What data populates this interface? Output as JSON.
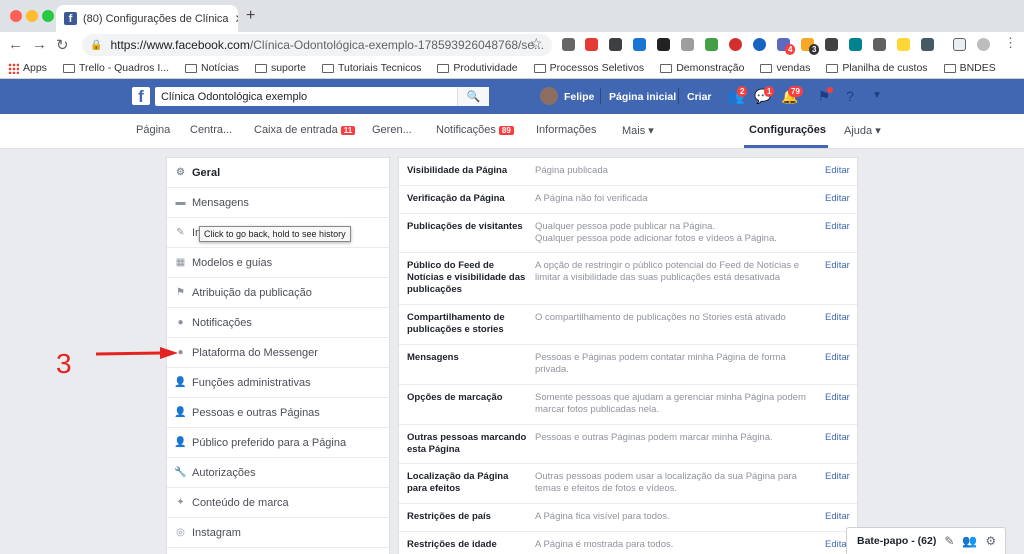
{
  "browser": {
    "tab_title": "(80) Configurações de Clínica",
    "url_host": "https://www.facebook.com",
    "url_path": "/Clínica-Odontológica-exemplo-178593926048768/se...",
    "bookmarks": [
      "Apps",
      "Trello - Quadros I...",
      "Notícias",
      "suporte",
      "Tutoriais Tecnicos",
      "Produtividade",
      "Processos Seletivos",
      "Demonstração",
      "vendas",
      "Planilha de custos",
      "BNDES"
    ],
    "ext_badges": {
      "a": "4",
      "b": "3"
    }
  },
  "fb": {
    "search_value": "Clínica Odontológica exemplo",
    "user": "Felipe",
    "home": "Página inicial",
    "create": "Criar",
    "friends_count": "2",
    "messages_count": "1",
    "notif_count": "79"
  },
  "pagenav": {
    "items": [
      "Página",
      "Centra...",
      "Caixa de entrada",
      "Geren...",
      "Notificações",
      "Informações",
      "Mais ▾",
      "Configurações",
      "Ajuda ▾"
    ],
    "inbox_badge": "11",
    "notif_badge": "89"
  },
  "sidebar": {
    "items": [
      "Geral",
      "Mensagens",
      "In",
      "Modelos e guias",
      "Atribuição da publicação",
      "Notificações",
      "Plataforma do Messenger",
      "Funções administrativas",
      "Pessoas e outras Páginas",
      "Público preferido para a Página",
      "Autorizações",
      "Conteúdo de marca",
      "Instagram"
    ],
    "tooltip": "Click to go back, hold to see history"
  },
  "annotation": "3",
  "settings": {
    "edit_label": "Editar",
    "rows": [
      {
        "label": "Visibilidade da Página",
        "desc": "Página publicada"
      },
      {
        "label": "Verificação da Página",
        "desc": "A Página não foi verificada"
      },
      {
        "label": "Publicações de visitantes",
        "desc": "Qualquer pessoa pode publicar na Página.\nQualquer pessoa pode adicionar fotos e vídeos à Página."
      },
      {
        "label": "Público do Feed de Notícias e visibilidade das publicações",
        "desc": "A opção de restringir o público potencial do Feed de Notícias e limitar a visibilidade das suas publicações está desativada"
      },
      {
        "label": "Compartilhamento de publicações e stories",
        "desc": "O compartilhamento de publicações no Stories está ativado"
      },
      {
        "label": "Mensagens",
        "desc": "Pessoas e Páginas podem contatar minha Página de forma privada."
      },
      {
        "label": "Opções de marcação",
        "desc": "Somente pessoas que ajudam a gerenciar minha Página podem marcar fotos publicadas nela."
      },
      {
        "label": "Outras pessoas marcando esta Página",
        "desc": "Pessoas e outras Páginas podem marcar minha Página."
      },
      {
        "label": "Localização da Página para efeitos",
        "desc": "Outras pessoas podem usar a localização da sua Página para temas e efeitos de fotos e vídeos."
      },
      {
        "label": "Restrições de país",
        "desc": "A Página fica visível para todos."
      },
      {
        "label": "Restrições de idade",
        "desc": "A Página é mostrada para todos."
      }
    ]
  },
  "chat": {
    "label": "Bate-papo - (62)"
  }
}
